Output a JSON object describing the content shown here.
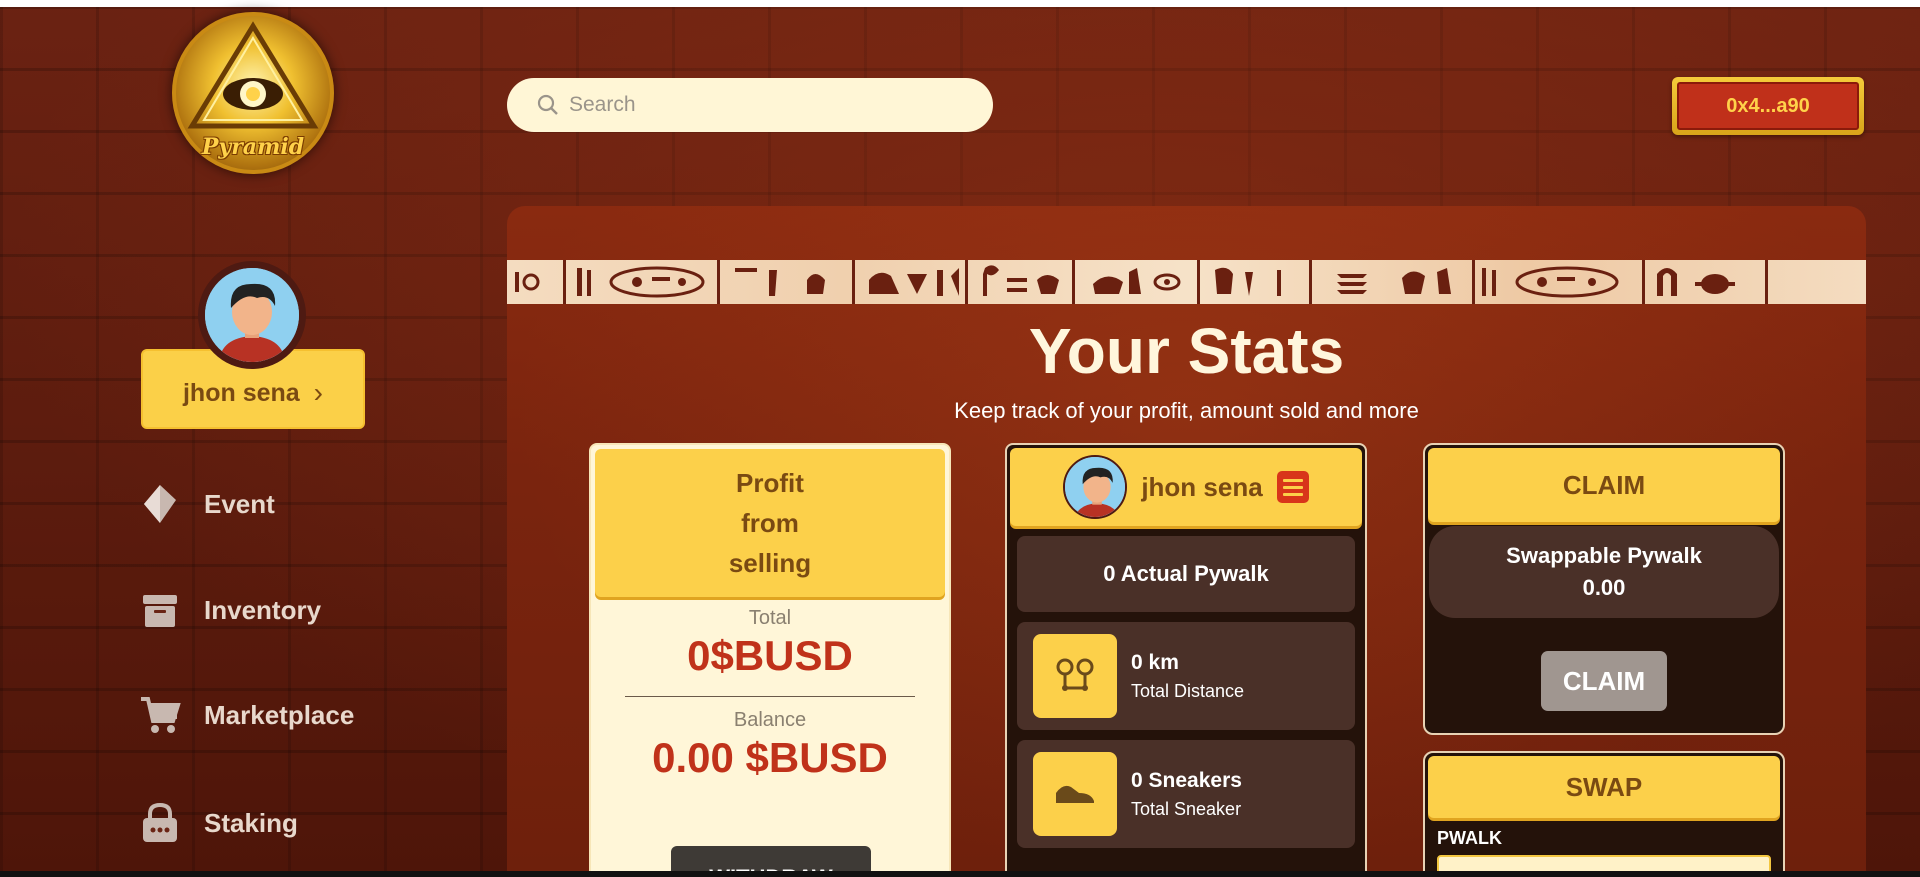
{
  "brand": {
    "name": "Pyramid"
  },
  "search": {
    "placeholder": "Search"
  },
  "wallet": {
    "address": "0x4...a90"
  },
  "user": {
    "name": "jhon sena"
  },
  "sidebar": {
    "items": [
      {
        "label": "Event",
        "icon": "diamond-icon"
      },
      {
        "label": "Inventory",
        "icon": "archive-box-icon"
      },
      {
        "label": "Marketplace",
        "icon": "cart-icon"
      },
      {
        "label": "Staking",
        "icon": "lock-icon"
      }
    ]
  },
  "stats": {
    "title": "Your Stats",
    "subtitle": "Keep track of your profit, amount sold and more"
  },
  "profit_card": {
    "header": "Profit from selling",
    "total_label": "Total",
    "total_value": "0$BUSD",
    "balance_label": "Balance",
    "balance_value": "0.00 $BUSD",
    "withdraw_label": "WITHDRAW"
  },
  "user_card": {
    "name": "jhon sena",
    "actual_pywalk": "0 Actual Pywalk",
    "distance_value": "0 km",
    "distance_label": "Total Distance",
    "sneakers_value": "0 Sneakers",
    "sneakers_label": "Total Sneaker"
  },
  "claim_card": {
    "header": "CLAIM",
    "swappable_label": "Swappable Pywalk",
    "swappable_value": "0.00",
    "button_label": "CLAIM"
  },
  "swap_card": {
    "header": "SWAP",
    "token_label": "PWALK"
  },
  "colors": {
    "accent_yellow": "#fcd04a",
    "brand_red": "#c0321a",
    "panel_red": "#7a240e",
    "dark_card": "#24120a"
  }
}
